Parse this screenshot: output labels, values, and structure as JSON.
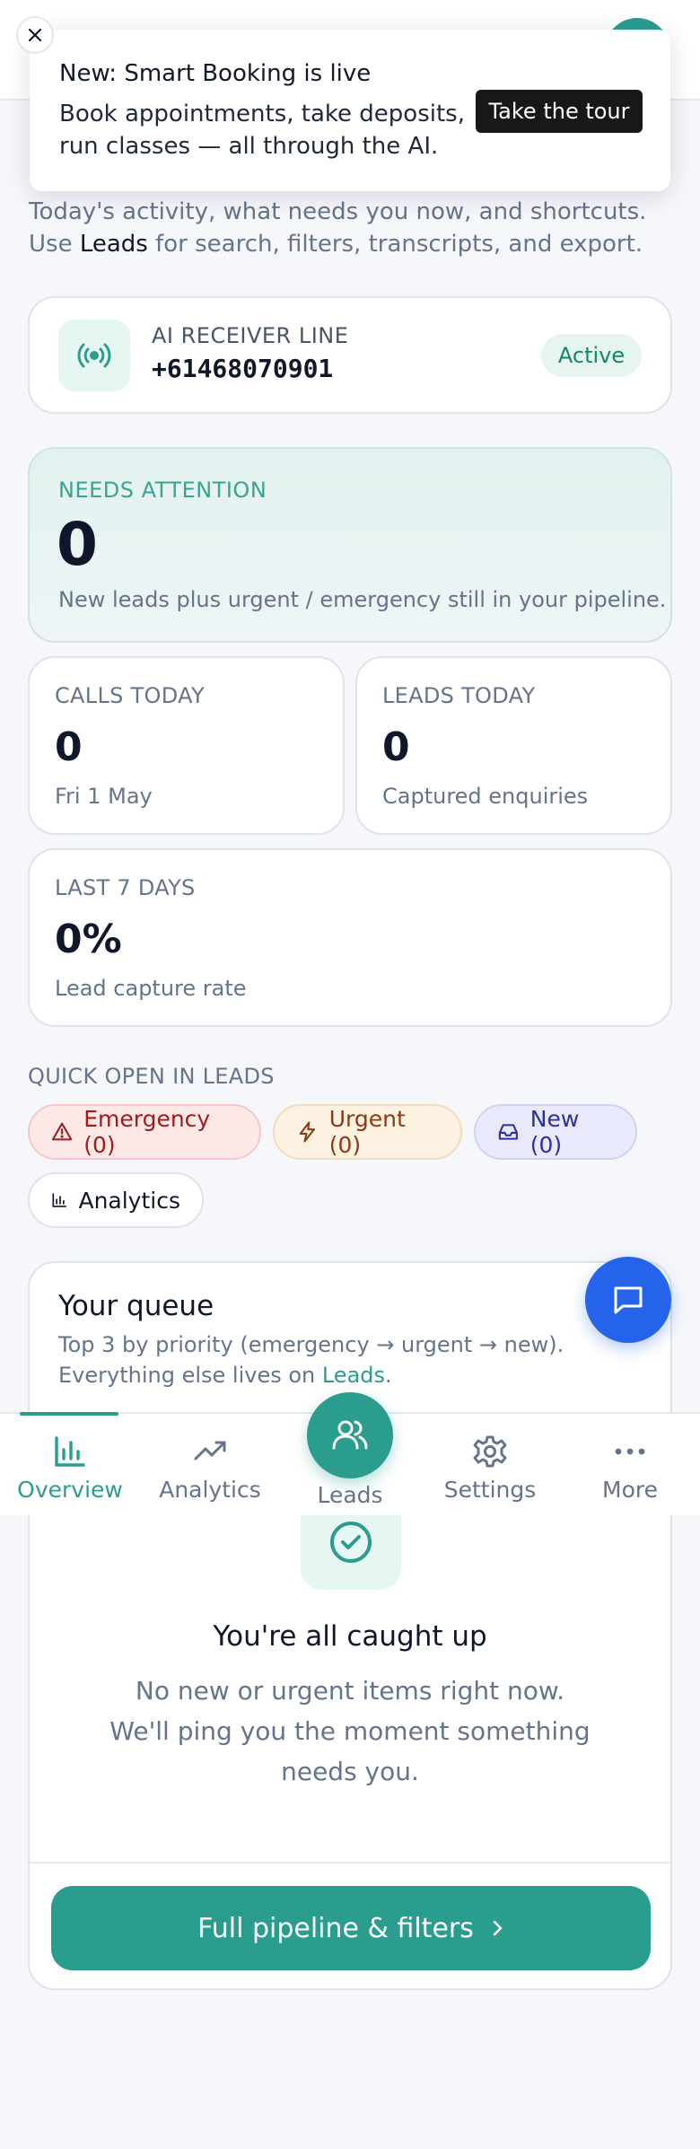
{
  "announcement": {
    "title": "New: Smart Booking is live",
    "body": "Book appointments, take deposits, run classes — all through the AI.",
    "cta_label": "Take the tour"
  },
  "intro": {
    "text_before": "Today's activity, what needs you now, and shortcuts. Use ",
    "link_text": "Leads",
    "text_after": " for search, filters, transcripts, and export."
  },
  "receiver": {
    "label": "AI RECEIVER LINE",
    "number": "+61468070901",
    "status": "Active"
  },
  "attention": {
    "label": "NEEDS ATTENTION",
    "value": "0",
    "description": "New leads plus urgent / emergency still in your pipeline."
  },
  "stats": {
    "calls": {
      "label": "CALLS TODAY",
      "value": "0",
      "sub": "Fri 1 May"
    },
    "leads": {
      "label": "LEADS TODAY",
      "value": "0",
      "sub": "Captured enquiries"
    },
    "last7": {
      "label": "LAST 7 DAYS",
      "value": "0%",
      "sub": "Lead capture rate"
    }
  },
  "quick_open": {
    "title": "QUICK OPEN IN LEADS",
    "chips": {
      "emergency": "Emergency (0)",
      "urgent": "Urgent (0)",
      "new": "New (0)",
      "analytics": "Analytics"
    }
  },
  "queue": {
    "title": "Your queue",
    "desc_before": "Top 3 by priority (emergency → urgent → new). Everything else lives on ",
    "desc_link": "Leads",
    "desc_after": ".",
    "empty_title": "You're all caught up",
    "empty_desc": "No new or urgent items right now. We'll ping you the moment something needs you.",
    "button_label": "Full pipeline & filters"
  },
  "nav": {
    "overview": "Overview",
    "analytics": "Analytics",
    "leads": "Leads",
    "settings": "Settings",
    "more": "More"
  },
  "colors": {
    "accent": "#2a9d8f",
    "chat_fab": "#2563eb",
    "emergency": "#a01c1c",
    "urgent": "#8a3b12",
    "new": "#2d2fa0"
  },
  "icons": {
    "announce_close": "close-icon",
    "receiver": "broadcast-icon",
    "emergency": "warning-triangle-icon",
    "urgent": "lightning-icon",
    "new": "inbox-icon",
    "analytics": "bar-chart-icon",
    "chat": "chat-bubble-icon",
    "empty": "check-circle-icon",
    "button": "chevron-right-icon",
    "nav_overview": "bar-chart-icon",
    "nav_analytics": "trending-up-icon",
    "nav_leads": "users-icon",
    "nav_settings": "gear-icon",
    "nav_more": "more-dots-icon"
  }
}
